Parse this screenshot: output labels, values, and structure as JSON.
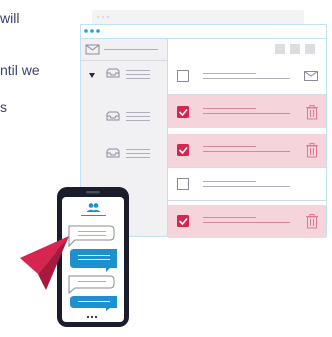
{
  "intro_text": {
    "line1": "will",
    "line2": "ntil we",
    "line3": "s"
  },
  "colors": {
    "text": "#3b3f72",
    "accent_blue": "#1e9fe0",
    "window_border": "#bfe3f5",
    "selected_row": "#f6d4dc",
    "checkbox_checked": "#d6254f",
    "trash": "#e07a94",
    "phone_frame": "#1b1c2c",
    "chat_blue": "#1e90cc",
    "plane": "#d6254f"
  },
  "email_rows": [
    {
      "selected": false,
      "trailing_icon": "envelope-icon"
    },
    {
      "selected": true,
      "trailing_icon": "trash-icon"
    },
    {
      "selected": true,
      "trailing_icon": "trash-icon"
    },
    {
      "selected": false,
      "trailing_icon": "none"
    },
    {
      "selected": true,
      "trailing_icon": "trash-icon"
    }
  ]
}
